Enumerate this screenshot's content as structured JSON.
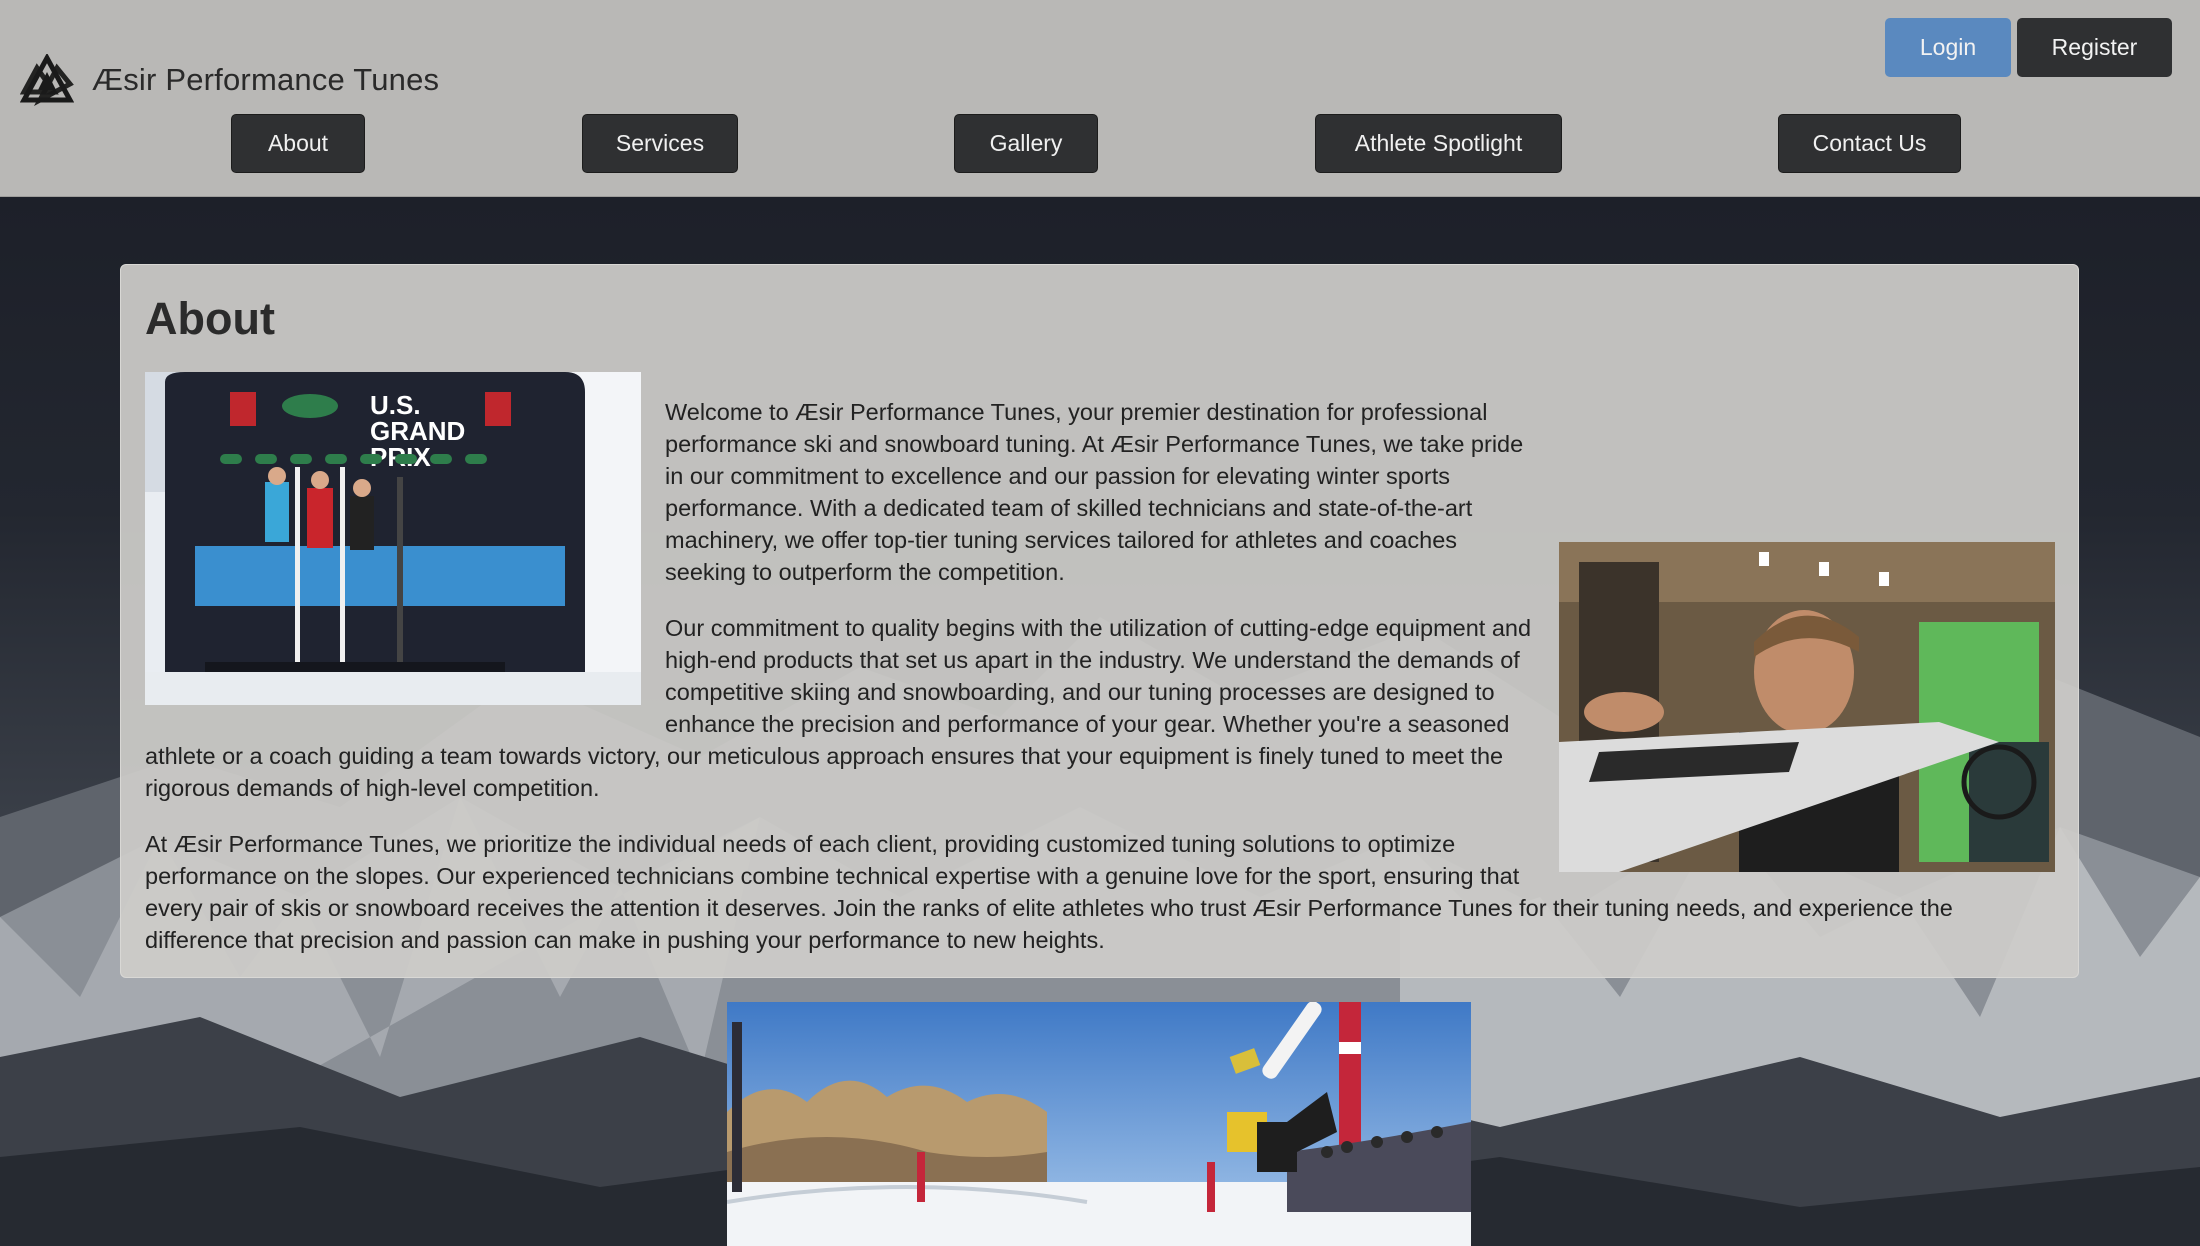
{
  "brand": {
    "name": "Æsir Performance Tunes",
    "logo_icon": "valknut-icon"
  },
  "auth": {
    "login_label": "Login",
    "register_label": "Register"
  },
  "nav": {
    "items": [
      {
        "label": "About"
      },
      {
        "label": "Services"
      },
      {
        "label": "Gallery"
      },
      {
        "label": "Athlete Spotlight"
      },
      {
        "label": "Contact Us"
      }
    ]
  },
  "about": {
    "title": "About",
    "paragraphs": [
      "Welcome to Æsir Performance Tunes, your premier destination for professional performance ski and snowboard tuning. At Æsir Performance Tunes, we take pride in our commitment to excellence and our passion for elevating winter sports performance. With a dedicated team of skilled technicians and state-of-the-art machinery, we offer top-tier tuning services tailored for athletes and coaches seeking to outperform the competition.",
      "Our commitment to quality begins with the utilization of cutting-edge equipment and high-end products that set us apart in the industry. We understand the demands of competitive skiing and snowboarding, and our tuning processes are designed to enhance the precision and performance of your gear. Whether you're a seasoned athlete or a coach guiding a team towards victory, our meticulous approach ensures that your equipment is finely tuned to meet the rigorous demands of high-level competition.",
      "At Æsir Performance Tunes, we prioritize the individual needs of each client, providing customized tuning solutions to optimize performance on the slopes. Our experienced technicians combine technical expertise with a genuine love for the sport, ensuring that every pair of skis or snowboard receives the attention it deserves. Join the ranks of elite athletes who trust Æsir Performance Tunes for their tuning needs, and experience the difference that precision and passion can make in pushing your performance to new heights."
    ],
    "podium_banner": {
      "line1": "U.S.",
      "line2": "GRAND",
      "line3": "PRIX"
    }
  },
  "colors": {
    "header_bg": "#b9b8b6",
    "login_bg": "#5a89bf",
    "dark_button": "#2f3032",
    "card_bg": "#cdccc9"
  }
}
